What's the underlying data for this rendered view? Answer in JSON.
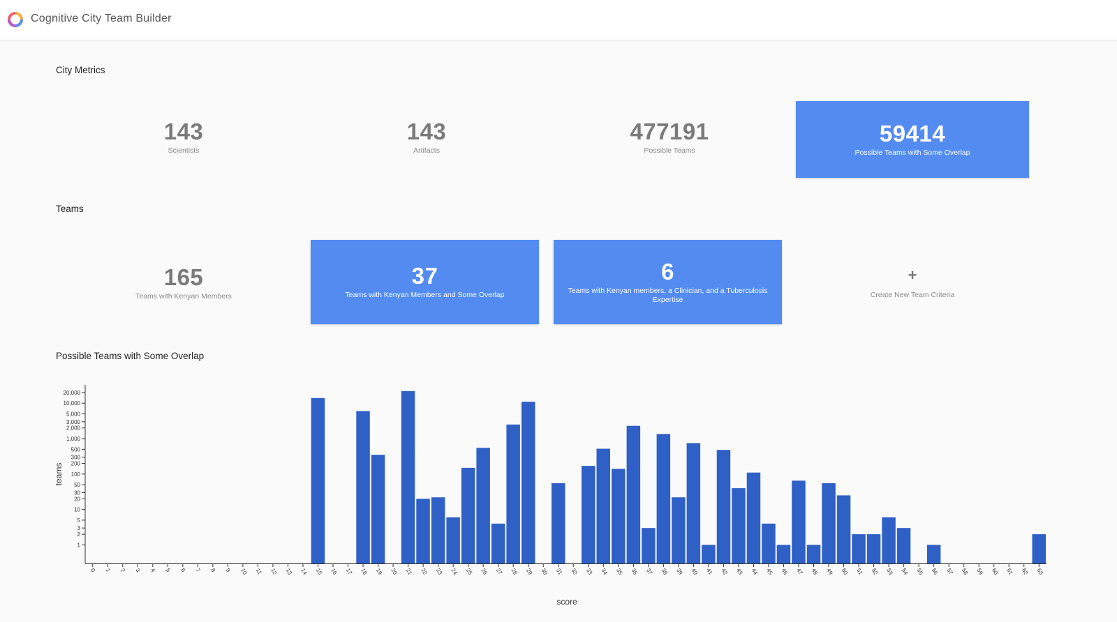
{
  "app": {
    "title": "Cognitive City Team Builder",
    "logo_icon": "ring-logo-icon"
  },
  "sections": {
    "city_metrics": "City Metrics",
    "teams": "Teams",
    "chart": "Possible Teams with Some Overlap"
  },
  "city_metrics": [
    {
      "value": "143",
      "label": "Scientists",
      "style": "plain"
    },
    {
      "value": "143",
      "label": "Artifacts",
      "style": "plain"
    },
    {
      "value": "477191",
      "label": "Possible Teams",
      "style": "plain"
    },
    {
      "value": "59414",
      "label": "Possible Teams with Some Overlap",
      "style": "blue"
    }
  ],
  "teams": [
    {
      "value": "165",
      "label": "Teams with Kenyan Members",
      "style": "plain"
    },
    {
      "value": "37",
      "label": "Teams with Kenyan Members and Some Overlap",
      "style": "blue"
    },
    {
      "value": "6",
      "label": "Teams with Kenyan members, a Clinician, and a Tuberculosis Expertise",
      "style": "blue"
    },
    {
      "value": "+",
      "label": "Create New Team Criteria",
      "style": "plain"
    }
  ],
  "colors": {
    "accent": "#538bf1",
    "bar": "#2f60c6",
    "text": "#333333"
  },
  "chart_data": {
    "type": "bar",
    "title": "Possible Teams with Some Overlap",
    "xlabel": "score",
    "ylabel": "teams",
    "yscale": "log",
    "ylim": [
      0.3,
      30000
    ],
    "yticks": [
      {
        "v": 1,
        "label": "1"
      },
      {
        "v": 2,
        "label": "2"
      },
      {
        "v": 3,
        "label": "3"
      },
      {
        "v": 5,
        "label": "5"
      },
      {
        "v": 10,
        "label": "10"
      },
      {
        "v": 20,
        "label": "20"
      },
      {
        "v": 30,
        "label": "30"
      },
      {
        "v": 50,
        "label": "50"
      },
      {
        "v": 100,
        "label": "100"
      },
      {
        "v": 200,
        "label": "200"
      },
      {
        "v": 300,
        "label": "300"
      },
      {
        "v": 500,
        "label": "500"
      },
      {
        "v": 1000,
        "label": "1,000"
      },
      {
        "v": 2000,
        "label": "2,000"
      },
      {
        "v": 3000,
        "label": "3,000"
      },
      {
        "v": 5000,
        "label": "5,000"
      },
      {
        "v": 10000,
        "label": "10,000"
      },
      {
        "v": 20000,
        "label": "20,000"
      }
    ],
    "categories": [
      "0",
      "1",
      "2",
      "3",
      "4",
      "5",
      "6",
      "7",
      "8",
      "9",
      "10",
      "11",
      "12",
      "13",
      "14",
      "15",
      "16",
      "17",
      "18",
      "19",
      "20",
      "21",
      "22",
      "23",
      "24",
      "25",
      "26",
      "27",
      "28",
      "29",
      "30",
      "31",
      "32",
      "33",
      "34",
      "35",
      "36",
      "37",
      "38",
      "39",
      "40",
      "41",
      "42",
      "43",
      "44",
      "45",
      "46",
      "47",
      "48",
      "49",
      "50",
      "51",
      "52",
      "53",
      "54",
      "55",
      "56",
      "57",
      "58",
      "59",
      "60",
      "61",
      "62",
      "63"
    ],
    "values": [
      0,
      0,
      0,
      0,
      0,
      0,
      0,
      0,
      0,
      0,
      0,
      0,
      0,
      0,
      0,
      14000,
      0,
      0,
      6000,
      350,
      0,
      22000,
      20,
      22,
      6,
      150,
      550,
      4,
      2500,
      11000,
      0,
      55,
      0,
      170,
      520,
      140,
      2300,
      3,
      1350,
      22,
      750,
      1,
      480,
      40,
      110,
      4,
      1,
      65,
      1,
      55,
      25,
      2,
      2,
      6,
      3,
      0,
      1,
      0,
      0,
      0,
      0,
      0,
      0,
      2
    ]
  }
}
